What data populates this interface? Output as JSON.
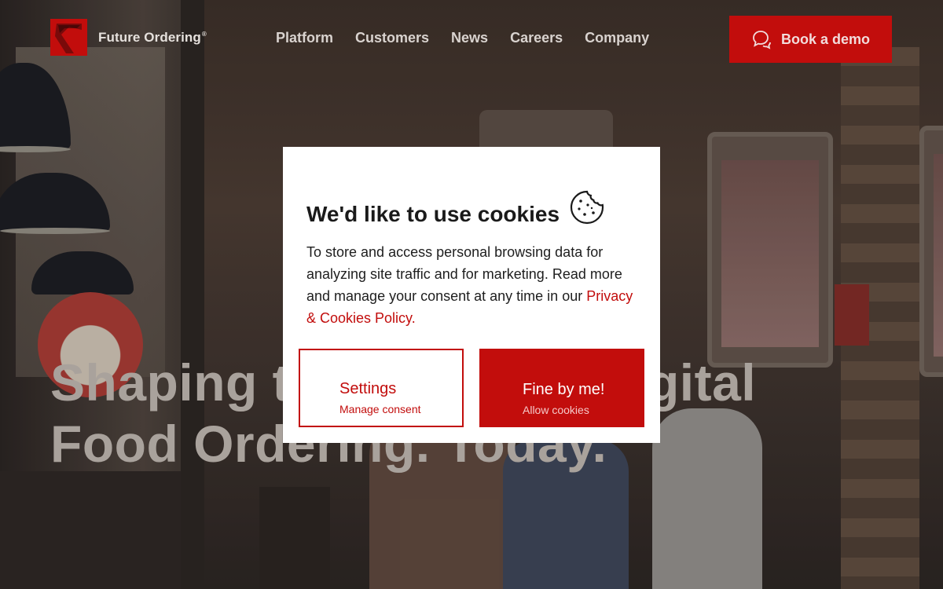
{
  "header": {
    "brand": "Future Ordering",
    "brand_mark": "®",
    "nav": [
      {
        "label": "Platform"
      },
      {
        "label": "Customers"
      },
      {
        "label": "News"
      },
      {
        "label": "Careers"
      },
      {
        "label": "Company"
      }
    ],
    "cta_label": "Book a demo",
    "cta_icon": "chat-bubble-icon"
  },
  "hero": {
    "line1": "Shaping the future of Digital",
    "line2": "Food Ordering. Today."
  },
  "cookie_dialog": {
    "title": "We'd like to use cookies",
    "icon": "cookie-icon",
    "body": "To store and access personal browsing data for analyzing site traffic and for marketing. Read more and manage your consent at any time in our ",
    "policy_link": "Privacy & Cookies Policy.",
    "settings_label": "Settings",
    "settings_sub": "Manage consent",
    "accept_label": "Fine by me!",
    "accept_sub": "Allow cookies"
  },
  "colors": {
    "brand_red": "#c20d0c",
    "dialog_bg": "#ffffff",
    "text_dark": "#1e1e1e"
  }
}
